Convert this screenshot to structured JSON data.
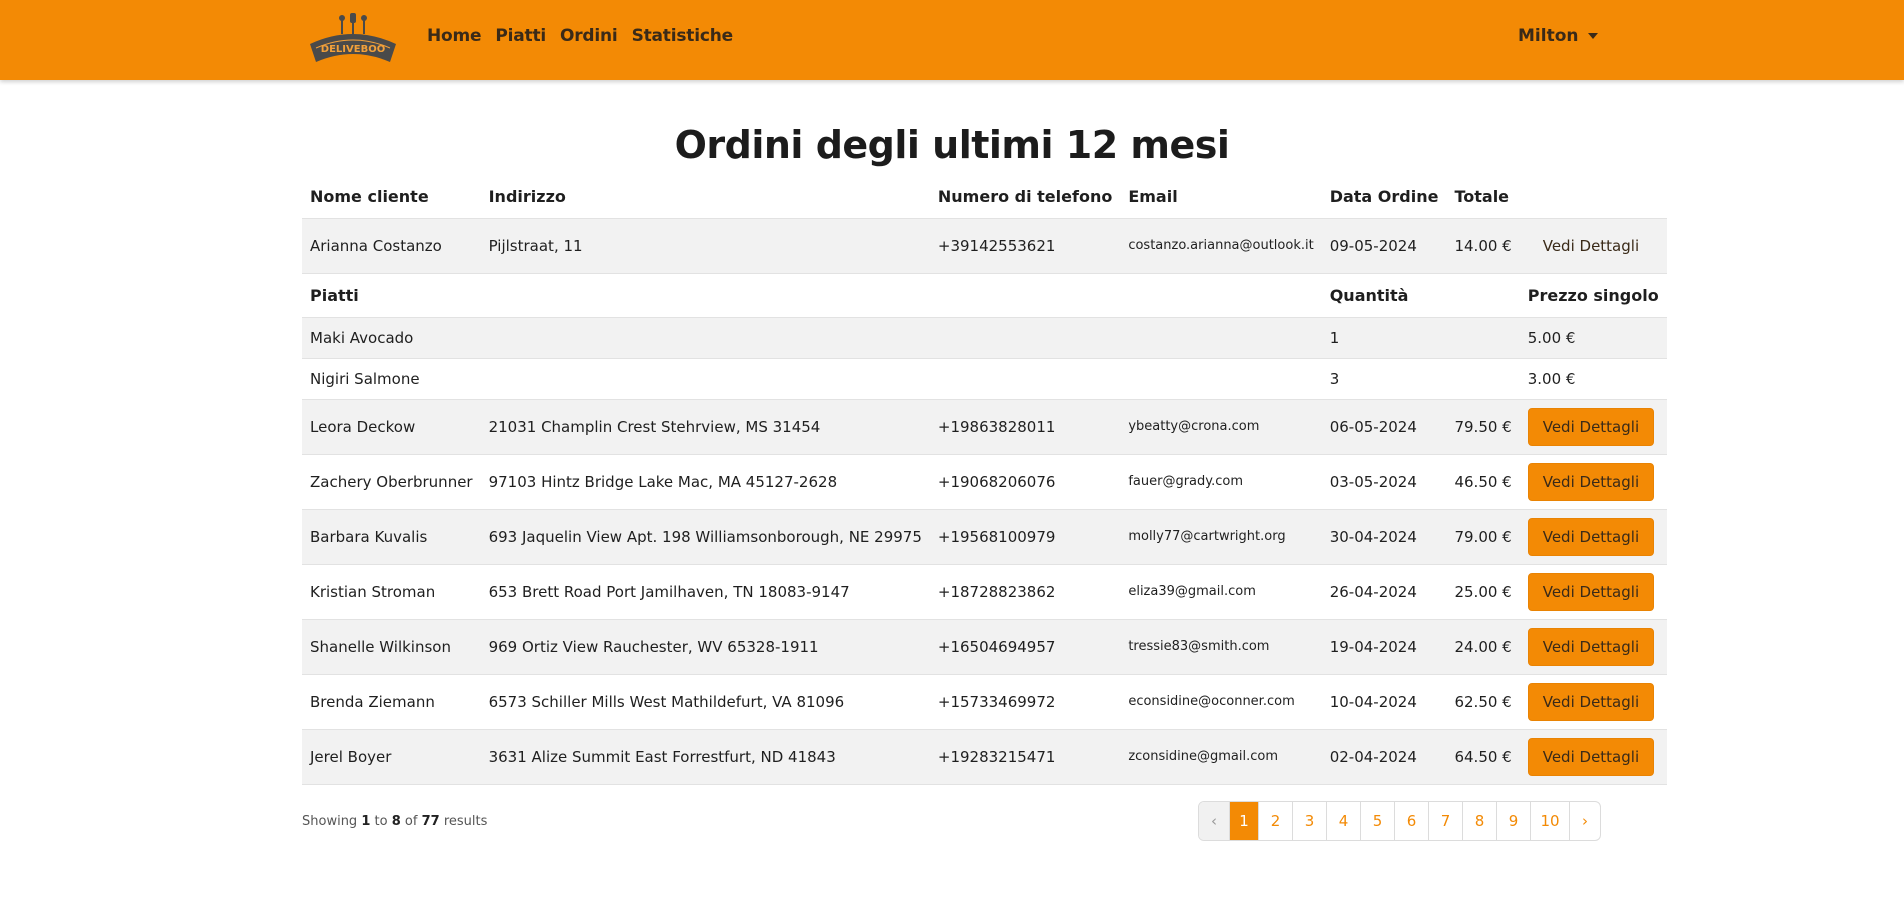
{
  "nav": {
    "logo_text": "DELIVEBOO",
    "links": [
      "Home",
      "Piatti",
      "Ordini",
      "Statistiche"
    ],
    "user": "Milton"
  },
  "page": {
    "title": "Ordini degli ultimi 12 mesi"
  },
  "table": {
    "headers": [
      "Nome cliente",
      "Indirizzo",
      "Numero di telefono",
      "Email",
      "Data Ordine",
      "Totale"
    ],
    "details_label": "Vedi Dettagli",
    "expanded": {
      "name": "Arianna Costanzo",
      "address": "Pijlstraat, 11",
      "phone": "+39142553621",
      "email": "costanzo.arianna@outlook.it",
      "date": "09-05-2024",
      "total": "14.00 €",
      "dish_headers": [
        "Piatti",
        "Quantità",
        "Prezzo singolo"
      ],
      "dishes": [
        {
          "name": "Maki Avocado",
          "qty": "1",
          "price": "5.00 €"
        },
        {
          "name": "Nigiri Salmone",
          "qty": "3",
          "price": "3.00 €"
        }
      ]
    },
    "rows": [
      {
        "name": "Leora Deckow",
        "address": "21031 Champlin Crest Stehrview, MS 31454",
        "phone": "+19863828011",
        "email": "ybeatty@crona.com",
        "date": "06-05-2024",
        "total": "79.50 €"
      },
      {
        "name": "Zachery Oberbrunner",
        "address": "97103 Hintz Bridge Lake Mac, MA 45127-2628",
        "phone": "+19068206076",
        "email": "fauer@grady.com",
        "date": "03-05-2024",
        "total": "46.50 €"
      },
      {
        "name": "Barbara Kuvalis",
        "address": "693 Jaquelin View Apt. 198 Williamsonborough, NE 29975",
        "phone": "+19568100979",
        "email": "molly77@cartwright.org",
        "date": "30-04-2024",
        "total": "79.00 €"
      },
      {
        "name": "Kristian Stroman",
        "address": "653 Brett Road Port Jamilhaven, TN 18083-9147",
        "phone": "+18728823862",
        "email": "eliza39@gmail.com",
        "date": "26-04-2024",
        "total": "25.00 €"
      },
      {
        "name": "Shanelle Wilkinson",
        "address": "969 Ortiz View Rauchester, WV 65328-1911",
        "phone": "+16504694957",
        "email": "tressie83@smith.com",
        "date": "19-04-2024",
        "total": "24.00 €"
      },
      {
        "name": "Brenda Ziemann",
        "address": "6573 Schiller Mills West Mathildefurt, VA 81096",
        "phone": "+15733469972",
        "email": "econsidine@oconner.com",
        "date": "10-04-2024",
        "total": "62.50 €"
      },
      {
        "name": "Jerel Boyer",
        "address": "3631 Alize Summit East Forrestfurt, ND 41843",
        "phone": "+19283215471",
        "email": "zconsidine@gmail.com",
        "date": "02-04-2024",
        "total": "64.50 €"
      }
    ]
  },
  "footer": {
    "showing_prefix": "Showing",
    "from": "1",
    "to_word": "to",
    "to": "8",
    "of_word": "of",
    "total": "77",
    "results_word": "results",
    "prev": "‹",
    "next": "›",
    "pages": [
      "1",
      "2",
      "3",
      "4",
      "5",
      "6",
      "7",
      "8",
      "9",
      "10"
    ],
    "active_page": "1"
  },
  "colors": {
    "accent": "#f38a05",
    "logo_dark": "#4a4a4a"
  }
}
